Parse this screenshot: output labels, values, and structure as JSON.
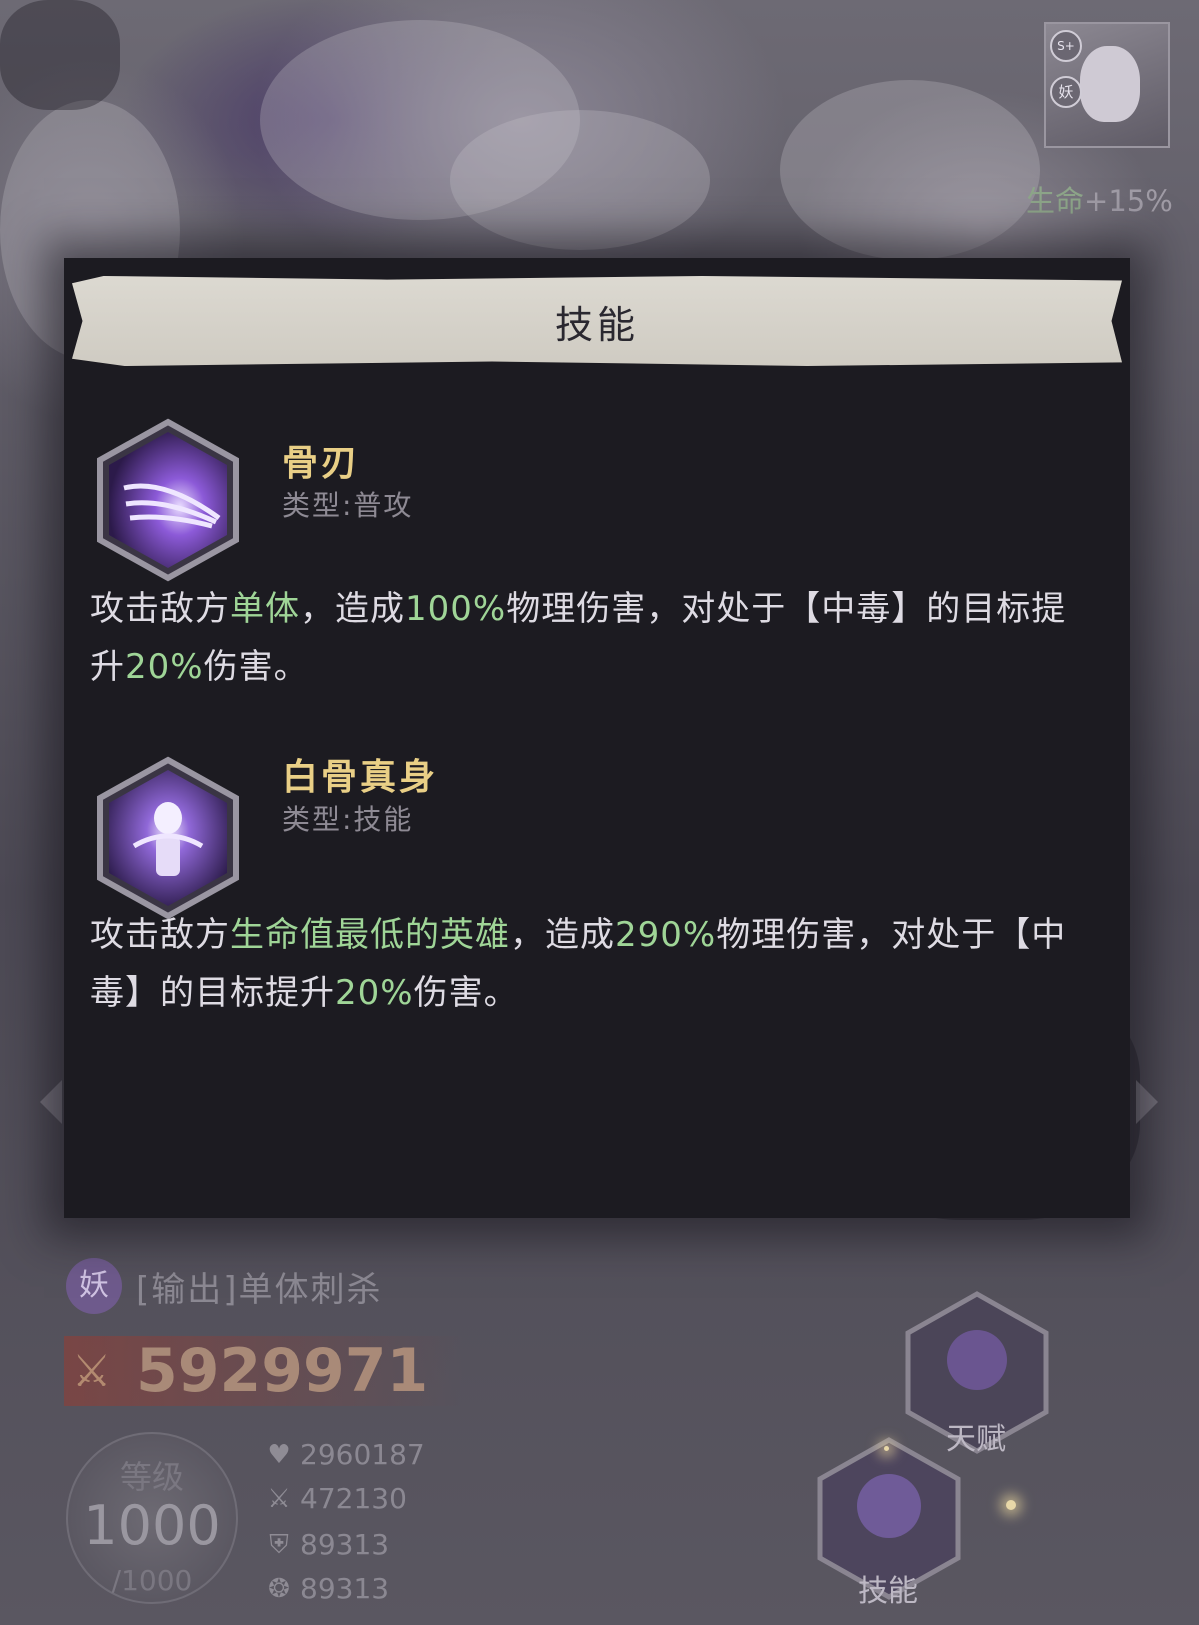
{
  "header": {
    "life_bonus_label": "生命",
    "life_bonus_value": "+15%",
    "portrait_badge_rank": "S+",
    "portrait_badge_faction": "妖"
  },
  "panel": {
    "title": "技能",
    "skills": [
      {
        "name": "骨刃",
        "type": "类型:普攻",
        "desc_parts": [
          "攻击敌方",
          "单体",
          "，造成",
          "100%",
          "物理伤害，对处于【中毒】的目标提升",
          "20%",
          "伤害。"
        ]
      },
      {
        "name": "白骨真身",
        "type": "类型:技能",
        "desc_parts": [
          "攻击敌方",
          "生命值最低的英雄",
          "，造成",
          "290%",
          "物理伤害，对处于【中毒】的目标提升",
          "20%",
          "伤害。"
        ]
      }
    ]
  },
  "hero": {
    "faction": "妖",
    "role": "[输出]单体刺杀",
    "power": "5929971",
    "level_label": "等级",
    "level": "1000",
    "level_max": "/1000",
    "stats": {
      "hp": "2960187",
      "attack": "472130",
      "defense": "89313",
      "speed": "89313"
    }
  },
  "buttons": {
    "talent": "天赋",
    "skill": "技能"
  },
  "colors": {
    "highlight": "#9fd597",
    "skill_name": "#e9cf86",
    "panel_bg": "#1c1b21"
  }
}
